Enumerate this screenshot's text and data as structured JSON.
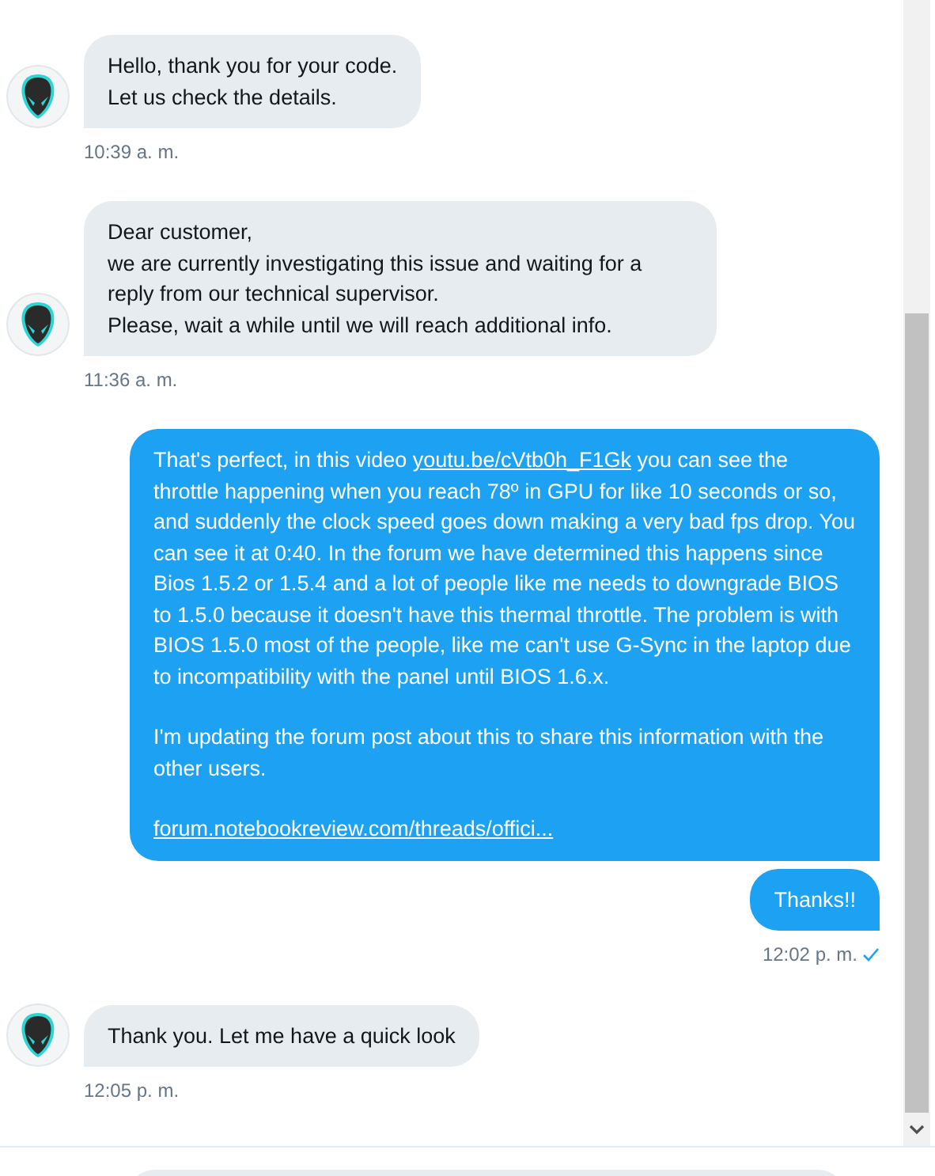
{
  "messages": [
    {
      "kind": "incoming",
      "paragraphs": [
        [
          {
            "kind": "text",
            "text": "Hello, thank you for your code.\nLet us check the details."
          }
        ]
      ],
      "time": "10:39 a. m.",
      "read": false
    },
    {
      "kind": "incoming",
      "paragraphs": [
        [
          {
            "kind": "text",
            "text": "Dear customer,\nwe are currently investigating this issue and waiting for a reply from our technical supervisor.\nPlease, wait a while until we will reach additional info."
          }
        ]
      ],
      "time": "11:36 a. m.",
      "read": false
    },
    {
      "kind": "outgoing",
      "paragraphs": [
        [
          {
            "kind": "text",
            "text": "That's perfect, in this video "
          },
          {
            "kind": "link",
            "text": "youtu.be/cVtb0h_F1Gk"
          },
          {
            "kind": "text",
            "text": " you can see the throttle happening when you reach 78º in GPU for like 10 seconds or so, and suddenly the clock speed goes down making a very bad fps drop. You can see it at 0:40. In the forum we have determined this happens since Bios 1.5.2 or 1.5.4 and a lot of people like me needs to downgrade BIOS to 1.5.0 because it doesn't have this thermal throttle. The problem is with BIOS 1.5.0 most of the people, like me can't use G-Sync in the laptop due to incompatibility with the panel until BIOS 1.6.x."
          }
        ],
        [
          {
            "kind": "text",
            "text": "I'm updating the forum post about this to share this information with the other users."
          }
        ],
        [
          {
            "kind": "link",
            "text": "forum.notebookreview.com/threads/offici..."
          }
        ]
      ]
    },
    {
      "kind": "outgoing",
      "paragraphs": [
        [
          {
            "kind": "text",
            "text": "Thanks!!"
          }
        ]
      ],
      "time": "12:02 p. m.",
      "read": true
    },
    {
      "kind": "incoming",
      "paragraphs": [
        [
          {
            "kind": "text",
            "text": "Thank you. Let me have a quick look"
          }
        ]
      ],
      "time": "12:05 p. m.",
      "read": false
    }
  ]
}
